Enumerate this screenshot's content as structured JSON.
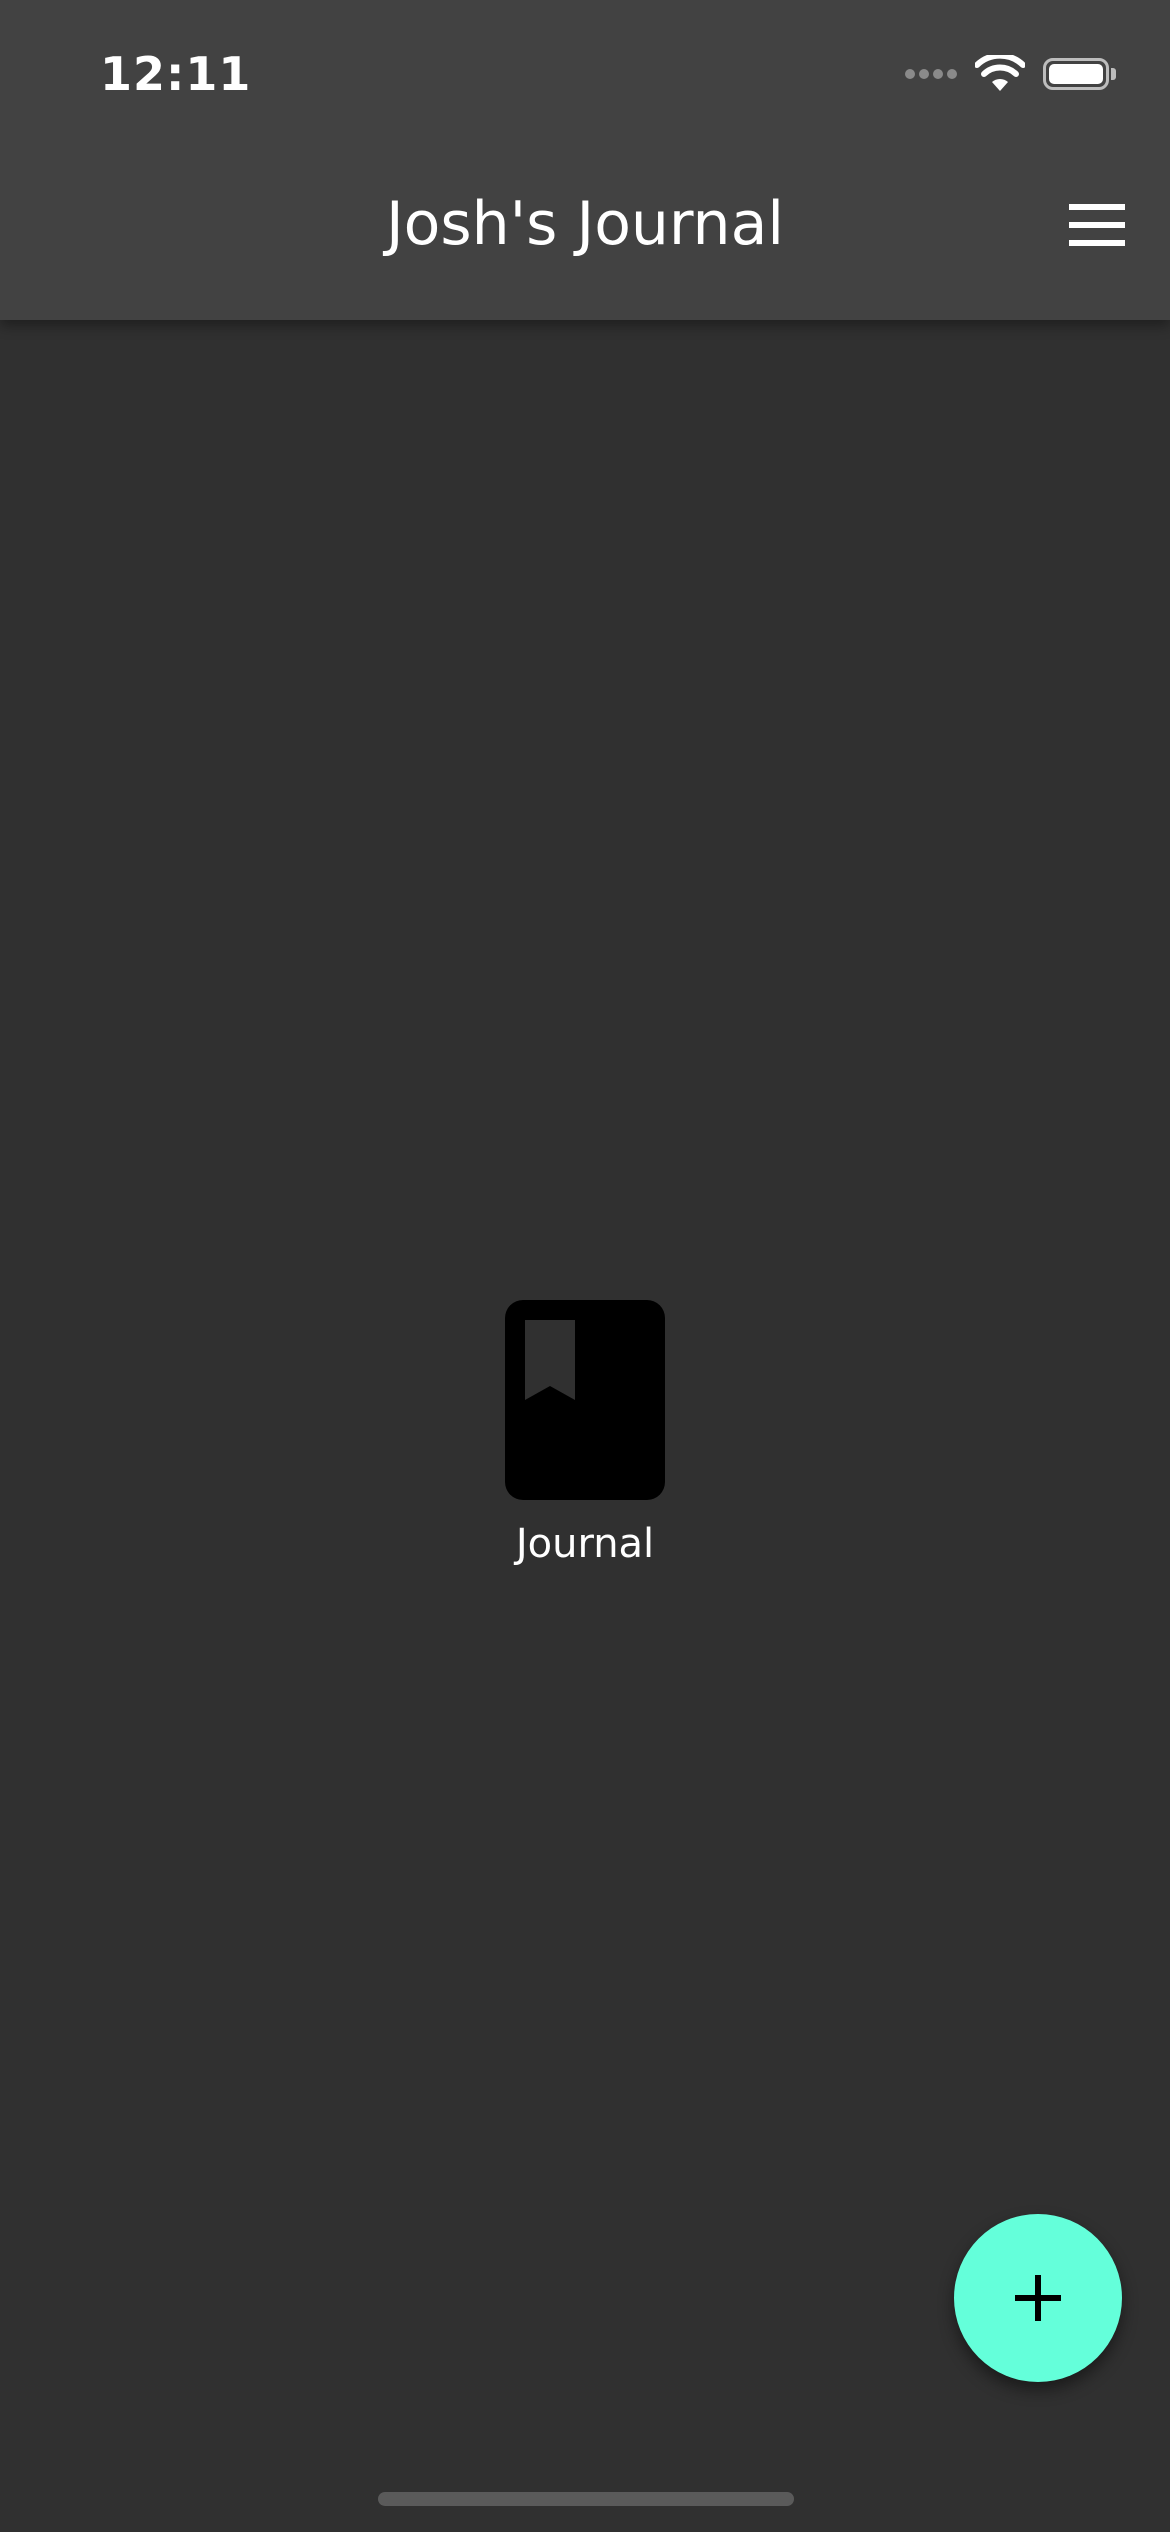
{
  "status_bar": {
    "time": "12:11",
    "signal_icon": "cellular-signal-icon",
    "wifi_icon": "wifi-icon",
    "battery_icon": "battery-icon",
    "battery_level": 1.0
  },
  "app_bar": {
    "title": "Josh's Journal",
    "menu_icon": "hamburger-menu-icon"
  },
  "main": {
    "item": {
      "icon": "bookmarked-book-icon",
      "label": "Journal"
    }
  },
  "fab": {
    "icon": "plus-icon",
    "color": "#64ffda"
  },
  "colors": {
    "background": "#303030",
    "app_bar": "#424242",
    "accent": "#64ffda"
  }
}
